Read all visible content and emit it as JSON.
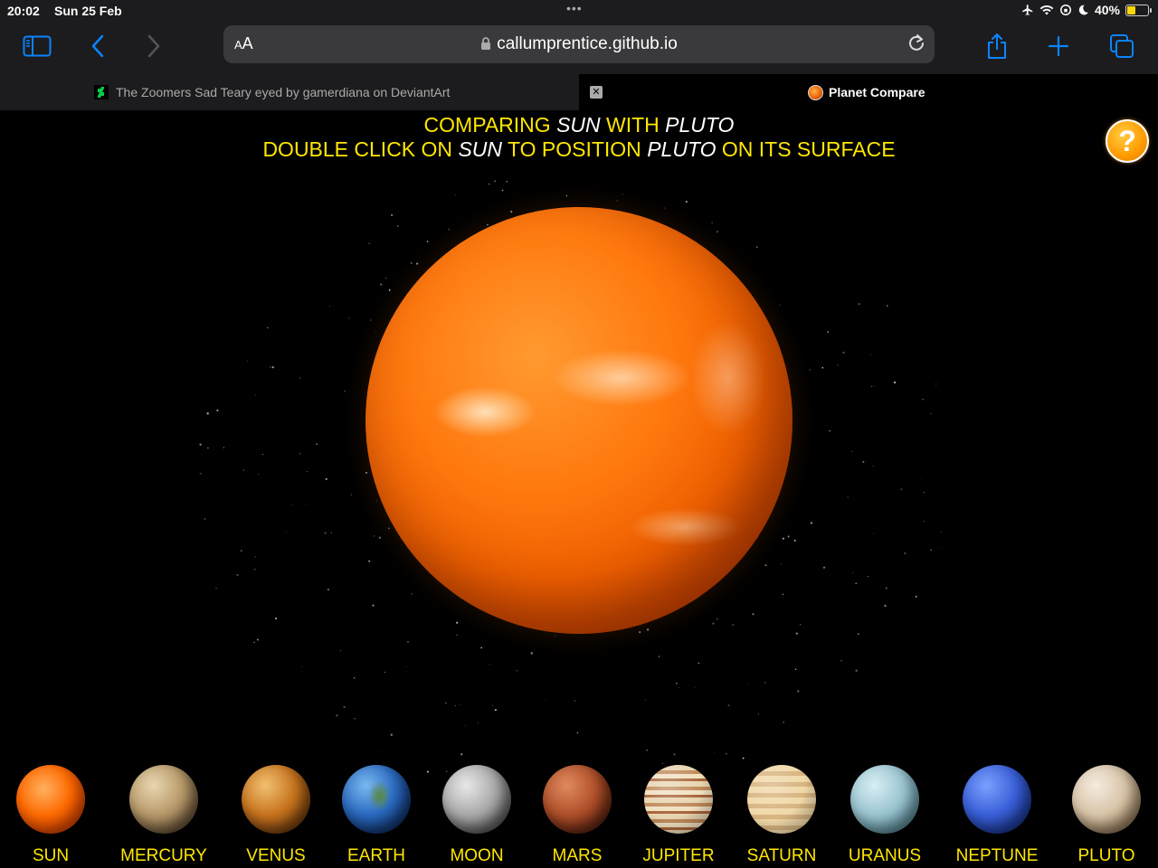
{
  "status_bar": {
    "time": "20:02",
    "date": "Sun 25 Feb",
    "dots": "•••",
    "battery_percent": "40%",
    "battery_level": 0.4
  },
  "toolbar": {
    "aa_label_small": "A",
    "aa_label_large": "A",
    "url": "callumprentice.github.io"
  },
  "tabs": [
    {
      "title": "The Zoomers Sad Teary eyed by gamerdiana on DeviantArt",
      "active": false
    },
    {
      "title": "Planet Compare",
      "active": true
    }
  ],
  "page": {
    "line1": {
      "prefix": "COMPARING ",
      "subject": "SUN",
      "middle": " WITH ",
      "target": "PLUTO"
    },
    "line2": {
      "prefix": "DOUBLE CLICK ON ",
      "subject": "SUN",
      "middle": " TO POSITION ",
      "target": "PLUTO",
      "suffix": " ON ITS SURFACE"
    },
    "help_label": "?",
    "planets": [
      {
        "name": "SUN"
      },
      {
        "name": "MERCURY"
      },
      {
        "name": "VENUS"
      },
      {
        "name": "EARTH"
      },
      {
        "name": "MOON"
      },
      {
        "name": "MARS"
      },
      {
        "name": "JUPITER"
      },
      {
        "name": "SATURN"
      },
      {
        "name": "URANUS"
      },
      {
        "name": "NEPTUNE"
      },
      {
        "name": "PLUTO"
      }
    ]
  },
  "colors": {
    "headline": "#ffe600",
    "accent_blue": "#0a84ff",
    "help_orange": "#ff9a00"
  }
}
